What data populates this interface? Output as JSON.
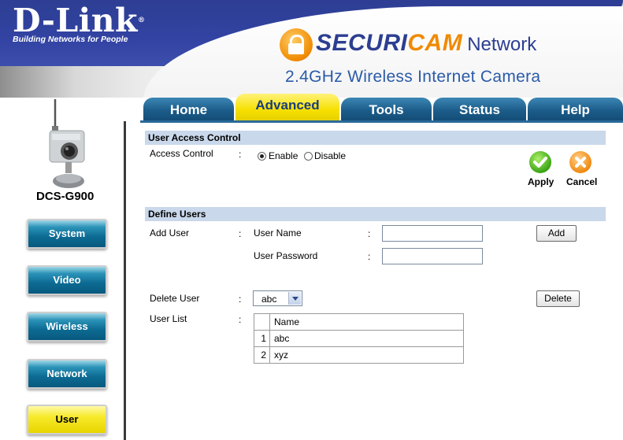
{
  "header": {
    "logo_main": "D-Link",
    "logo_tm": "®",
    "logo_tagline": "Building Networks for People",
    "brand_part1": "SECURI",
    "brand_part2": "CAM",
    "brand_part3": "Network",
    "brand_tm": "®",
    "model_title": "2.4GHz Wireless Internet Camera"
  },
  "tabs": [
    {
      "label": "Home",
      "active": false
    },
    {
      "label": "Advanced",
      "active": true
    },
    {
      "label": "Tools",
      "active": false
    },
    {
      "label": "Status",
      "active": false
    },
    {
      "label": "Help",
      "active": false
    }
  ],
  "sidebar": {
    "model": "DCS-G900",
    "items": [
      {
        "label": "System",
        "active": false
      },
      {
        "label": "Video",
        "active": false
      },
      {
        "label": "Wireless",
        "active": false
      },
      {
        "label": "Network",
        "active": false
      },
      {
        "label": "User",
        "active": true
      }
    ]
  },
  "access_control": {
    "section_title": "User Access Control",
    "label": "Access Control",
    "colon": ":",
    "enable_label": "Enable",
    "disable_label": "Disable",
    "selected": "Enable",
    "apply_label": "Apply",
    "cancel_label": "Cancel"
  },
  "define_users": {
    "section_title": "Define Users",
    "add_user_label": "Add User",
    "user_name_label": "User Name",
    "user_name_value": "",
    "user_password_label": "User Password",
    "user_password_value": "",
    "add_button": "Add",
    "delete_user_label": "Delete User",
    "delete_selected": "abc",
    "delete_button": "Delete",
    "user_list_label": "User List",
    "colon": ":",
    "table_header": "Name",
    "users": [
      {
        "num": "1",
        "name": "abc"
      },
      {
        "num": "2",
        "name": "xyz"
      }
    ]
  },
  "colors": {
    "tab_active": "#f6e000",
    "tab_inactive": "#1c5c8a",
    "section_bar": "#c9d8ea",
    "sidebar_button": "#0d6b93",
    "sidebar_button_active": "#f7ea2a"
  }
}
